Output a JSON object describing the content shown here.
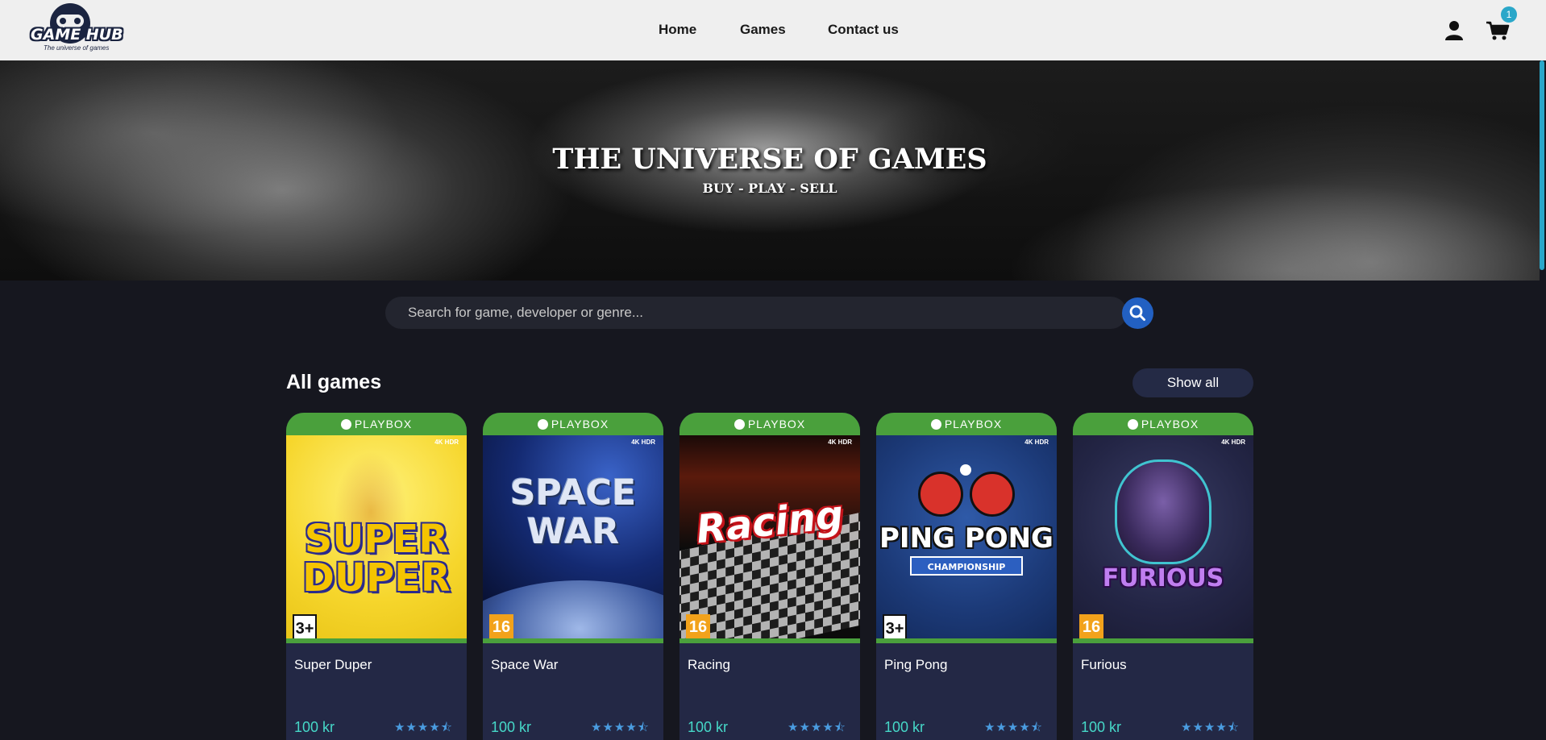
{
  "header": {
    "logo_text": "GAME HUB",
    "logo_tagline": "The universe of games",
    "nav": [
      "Home",
      "Games",
      "Contact us"
    ],
    "cart_count": "1"
  },
  "hero": {
    "title": "THE UNIVERSE OF GAMES",
    "subtitle": "BUY - PLAY - SELL"
  },
  "search": {
    "placeholder": "Search for game, developer or genre..."
  },
  "section": {
    "title": "All games",
    "show_all": "Show all"
  },
  "platform_label": "PLAYBOX",
  "cover_badge": "4K HDR",
  "games": [
    {
      "name": "Super Duper",
      "cover_title": "SUPER DUPER",
      "age": "3+",
      "price": "100 kr",
      "rating": 4.5
    },
    {
      "name": "Space War",
      "cover_title": "SPACE WAR",
      "age": "16",
      "price": "100 kr",
      "rating": 4.5
    },
    {
      "name": "Racing",
      "cover_title": "Racing",
      "age": "16",
      "price": "100 kr",
      "rating": 4.5
    },
    {
      "name": "Ping Pong",
      "cover_title": "PING PONG",
      "cover_subtitle": "CHAMPIONSHIP",
      "age": "3+",
      "price": "100 kr",
      "rating": 4.5
    },
    {
      "name": "Furious",
      "cover_title": "FURIOUS",
      "age": "16",
      "price": "100 kr",
      "rating": 4.5
    }
  ],
  "colors": {
    "accent_green": "#4aa03c",
    "price_teal": "#46d8c8",
    "search_button": "#2260c2",
    "card_bg": "#232845"
  }
}
